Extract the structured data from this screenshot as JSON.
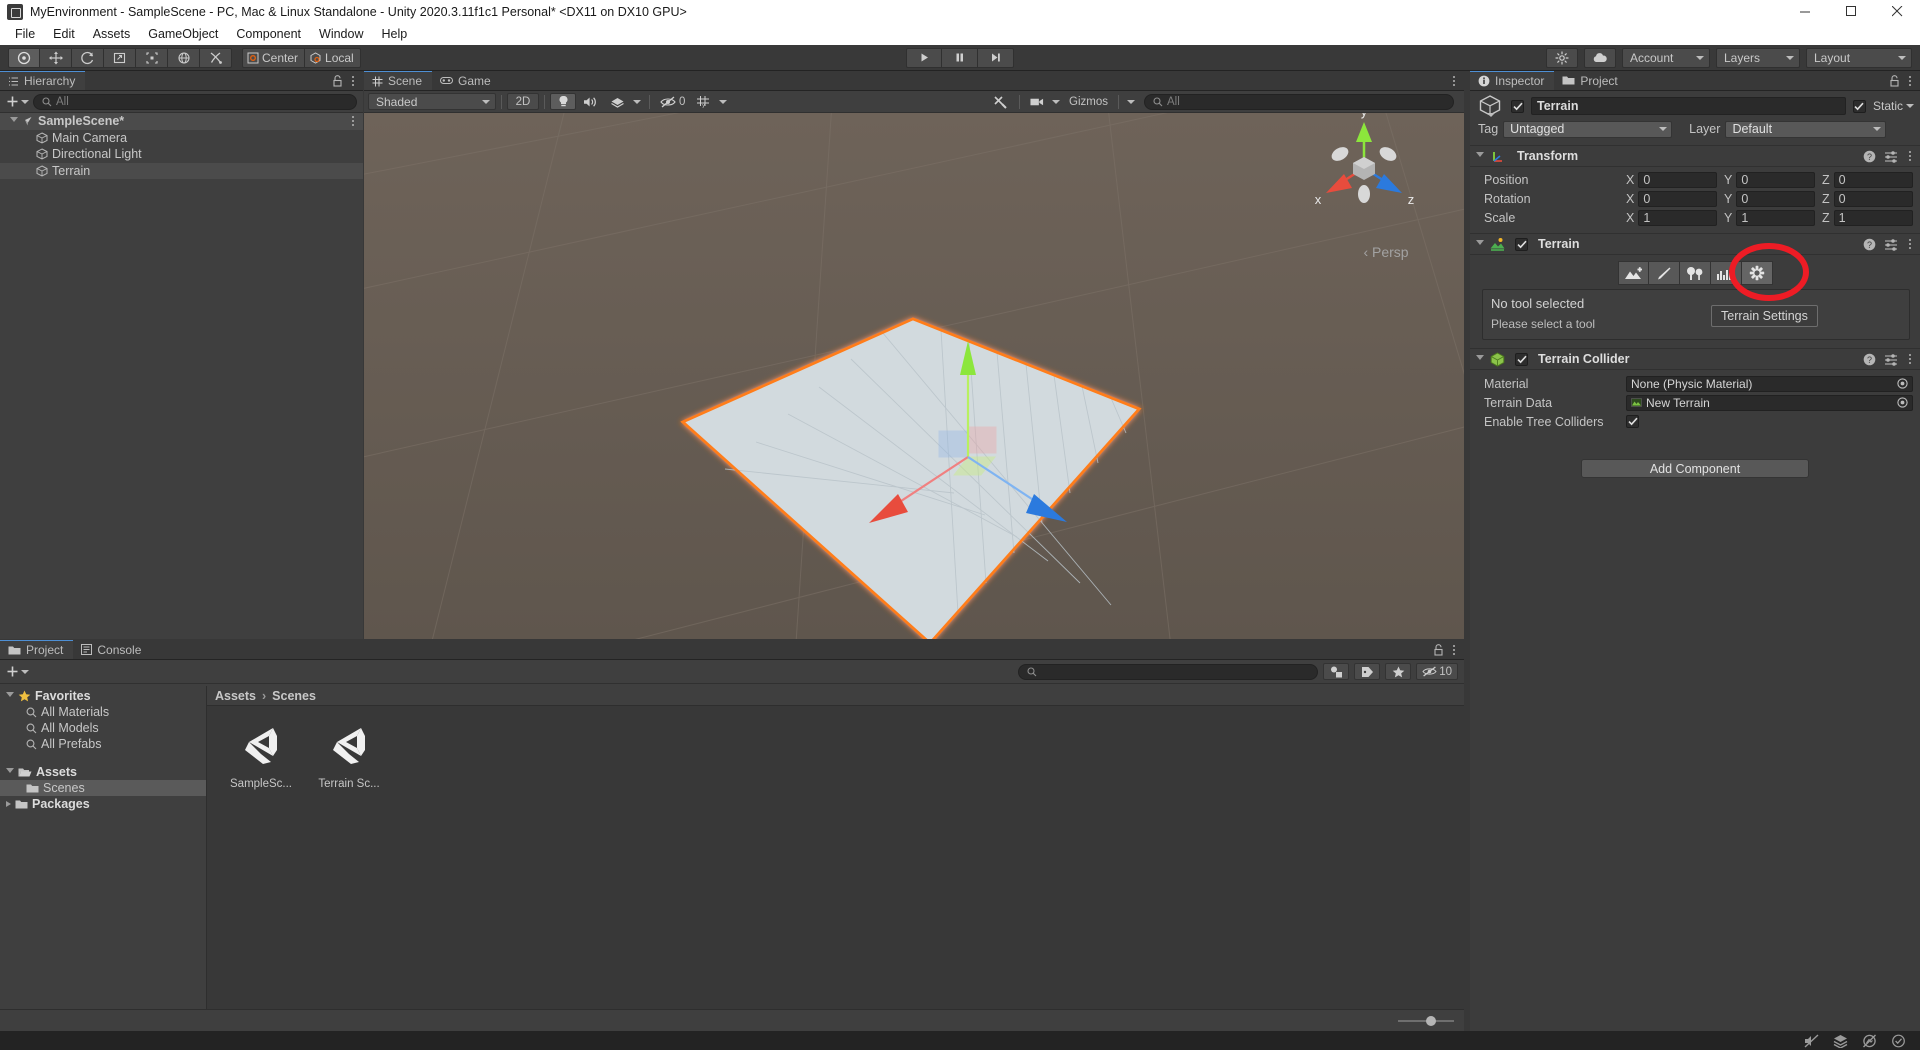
{
  "window": {
    "title": "MyEnvironment - SampleScene - PC, Mac & Linux Standalone - Unity 2020.3.11f1c1 Personal* <DX11 on DX10 GPU>",
    "app_icon": "unity-icon",
    "minimize": "minimize-icon",
    "maximize": "maximize-icon",
    "close": "close-icon"
  },
  "menubar": {
    "items": [
      "File",
      "Edit",
      "Assets",
      "GameObject",
      "Component",
      "Window",
      "Help"
    ]
  },
  "toolbar": {
    "tools": [
      {
        "name": "hand-tool",
        "selected": true
      },
      {
        "name": "move-tool",
        "selected": false
      },
      {
        "name": "rotate-tool",
        "selected": false
      },
      {
        "name": "scale-tool",
        "selected": false
      },
      {
        "name": "rect-tool",
        "selected": false
      },
      {
        "name": "transform-tool",
        "selected": false
      },
      {
        "name": "custom-editor-tool",
        "selected": false
      }
    ],
    "pivot_mode": "Center",
    "pivot_rotation": "Local",
    "play": "play-icon",
    "pause": "pause-icon",
    "step": "step-icon",
    "collab": "cloud-icon",
    "services": "services-icon",
    "account": "Account",
    "layers": "Layers",
    "layout": "Layout"
  },
  "hierarchy": {
    "tab": "Hierarchy",
    "search_placeholder": "All",
    "rows": [
      {
        "label": "SampleScene*",
        "type": "scene",
        "indent": 0,
        "selected": false
      },
      {
        "label": "Main Camera",
        "type": "gameobject",
        "indent": 1,
        "selected": false
      },
      {
        "label": "Directional Light",
        "type": "gameobject",
        "indent": 1,
        "selected": false
      },
      {
        "label": "Terrain",
        "type": "gameobject",
        "indent": 1,
        "selected": true
      }
    ]
  },
  "scene": {
    "tabs": [
      {
        "label": "Scene",
        "icon": "grid-icon",
        "active": true
      },
      {
        "label": "Game",
        "icon": "gamepad-icon",
        "active": false
      }
    ],
    "draw_mode": "Shaded",
    "mode_2d": "2D",
    "lighting": "lightbulb-icon",
    "audio": "speaker-icon",
    "fx": "fx-icon",
    "hidden_count": "0",
    "grid": "grid-visibility-icon",
    "tools": "scene-tools-icon",
    "camera": "scene-camera-icon",
    "gizmos": "Gizmos",
    "search_placeholder": "All",
    "gizmo_axes": {
      "x": "x",
      "y": "y",
      "z": "z"
    },
    "projection": "Persp",
    "selected_object": "Terrain",
    "selection_outline_color": "#ff7d1a"
  },
  "inspector": {
    "tabs": [
      {
        "label": "Inspector",
        "icon": "info-icon",
        "active": true
      },
      {
        "label": "Project",
        "icon": "folder-icon",
        "active": false
      }
    ],
    "lock": "lock-icon",
    "object_name": "Terrain",
    "object_enabled": true,
    "static_label": "Static",
    "static_checked": true,
    "tag_label": "Tag",
    "tag_value": "Untagged",
    "layer_label": "Layer",
    "layer_value": "Default",
    "transform": {
      "title": "Transform",
      "icon": "transform-icon",
      "rows": [
        {
          "label": "Position",
          "x": "0",
          "y": "0",
          "z": "0"
        },
        {
          "label": "Rotation",
          "x": "0",
          "y": "0",
          "z": "0"
        },
        {
          "label": "Scale",
          "x": "1",
          "y": "1",
          "z": "1"
        }
      ]
    },
    "terrain": {
      "title": "Terrain",
      "icon": "terrain-icon",
      "enabled": true,
      "tools": [
        {
          "name": "create-neighbor-terrains-tool",
          "selected": false
        },
        {
          "name": "paint-terrain-tool",
          "selected": false
        },
        {
          "name": "paint-trees-tool",
          "selected": false
        },
        {
          "name": "paint-details-tool",
          "selected": false
        },
        {
          "name": "terrain-settings-tool",
          "selected": true
        }
      ],
      "help_title": "No tool selected",
      "help_body": "Please select a tool",
      "tooltip": "Terrain Settings",
      "highlight_color": "#ee1c25"
    },
    "terrain_collider": {
      "title": "Terrain Collider",
      "icon": "collider-icon",
      "enabled": true,
      "rows": [
        {
          "label": "Material",
          "value": "None (Physic Material)",
          "type": "object"
        },
        {
          "label": "Terrain Data",
          "value": "New Terrain",
          "type": "object"
        },
        {
          "label": "Enable Tree Colliders",
          "value": "",
          "type": "checkbox",
          "checked": true
        }
      ]
    },
    "add_component": "Add Component"
  },
  "project": {
    "tabs": [
      {
        "label": "Project",
        "icon": "folder-icon",
        "active": true
      },
      {
        "label": "Console",
        "icon": "console-icon",
        "active": false
      }
    ],
    "search_placeholder": "",
    "filter_count": "10",
    "tree": [
      {
        "label": "Favorites",
        "indent": 0,
        "bold": true,
        "icon": "star-icon",
        "expanded": true
      },
      {
        "label": "All Materials",
        "indent": 1,
        "bold": false,
        "icon": "search-icon"
      },
      {
        "label": "All Models",
        "indent": 1,
        "bold": false,
        "icon": "search-icon"
      },
      {
        "label": "All Prefabs",
        "indent": 1,
        "bold": false,
        "icon": "search-icon"
      },
      {
        "label": "Assets",
        "indent": 0,
        "bold": true,
        "icon": "folder-open-icon",
        "expanded": true
      },
      {
        "label": "Scenes",
        "indent": 1,
        "bold": false,
        "icon": "folder-icon",
        "selected": true
      },
      {
        "label": "Packages",
        "indent": 0,
        "bold": true,
        "icon": "folder-icon",
        "expanded": false
      }
    ],
    "breadcrumb": [
      "Assets",
      "Scenes"
    ],
    "assets": [
      {
        "name": "SampleSc...",
        "icon": "unity-scene-icon"
      },
      {
        "name": "Terrain Sc...",
        "icon": "unity-scene-icon"
      }
    ]
  },
  "statusbar": {
    "icons": [
      "mute-audio-icon",
      "layers-status-icon",
      "no-preview-icon",
      "check-circle-icon"
    ]
  },
  "colors": {
    "accent_blue": "#4e8fd4",
    "selection_orange": "#ff7d1a",
    "annotation_red": "#ee1c25",
    "panel_bg": "#3f3f3f",
    "toolbar_bg": "#393939"
  }
}
